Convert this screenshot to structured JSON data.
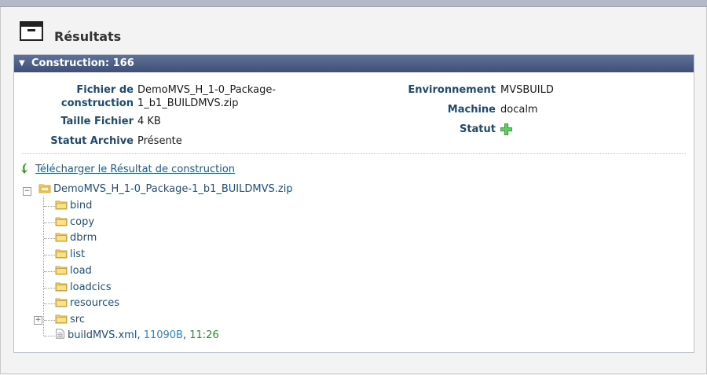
{
  "page": {
    "title": "Résultats"
  },
  "panel": {
    "title": "Construction: 166"
  },
  "details": {
    "file_label_line1": "Fichier de",
    "file_label_line2": "construction",
    "file_value_line1": "DemoMVS_H_1-0_Package-",
    "file_value_line2": "1_b1_BUILDMVS.zip",
    "size_label": "Taille Fichier",
    "size_value": "4 KB",
    "archive_label": "Statut Archive",
    "archive_value": "Présente",
    "env_label": "Environnement",
    "env_value": "MVSBUILD",
    "machine_label": "Machine",
    "machine_value": "docalm",
    "status_label": "Statut",
    "status_icon": "green-plus-icon"
  },
  "download": {
    "label": "Télécharger le Résultat de construction"
  },
  "tree": {
    "root": "DemoMVS_H_1-0_Package-1_b1_BUILDMVS.zip",
    "folders": [
      "bind",
      "copy",
      "dbrm",
      "list",
      "load",
      "loadcics",
      "resources",
      "src"
    ],
    "file": {
      "name": "buildMVS.xml",
      "size": "11090B",
      "time": "11:26"
    }
  },
  "colors": {
    "header_bar": "#4a5c84",
    "label_blue": "#204a6e",
    "link_blue": "#1b5b8f",
    "size_blue": "#2b86c8",
    "time_green": "#2f8a2f"
  }
}
